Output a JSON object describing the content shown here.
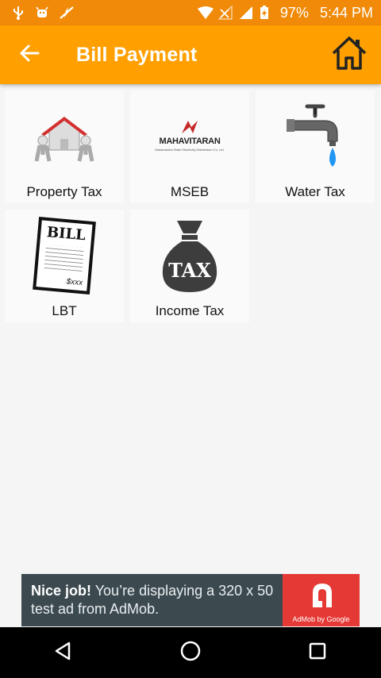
{
  "status_bar": {
    "battery": "97%",
    "time": "5:44 PM",
    "icons": [
      "usb-icon",
      "android-icon",
      "lightning-icon",
      "wifi-icon",
      "no-signal-icon",
      "signal-icon",
      "battery-charging-icon"
    ]
  },
  "app_bar": {
    "title": "Bill Payment",
    "back_icon": "arrow-left-icon",
    "home_icon": "home-icon",
    "color": "#ffa000"
  },
  "tiles": [
    {
      "label": "Property Tax",
      "icon": "house-movers-icon"
    },
    {
      "label": "MSEB",
      "icon": "mahavitaran-logo",
      "logo_text": "MAHAVITARAN",
      "logo_subtext": "Maharashtra State Electricity Distribution Co. Ltd."
    },
    {
      "label": "Water Tax",
      "icon": "faucet-icon"
    },
    {
      "label": "LBT",
      "icon": "bill-icon",
      "icon_text": "BILL",
      "icon_amount": "$xxx"
    },
    {
      "label": "Income Tax",
      "icon": "tax-bag-icon",
      "icon_text": "TAX"
    }
  ],
  "ad": {
    "headline": "Nice job!",
    "body": " You’re displaying a 320 x 50 test ad from AdMob.",
    "badge_caption": "AdMob by Google"
  },
  "nav_bar": {
    "buttons": [
      "back-triangle-icon",
      "home-circle-icon",
      "recents-square-icon"
    ]
  }
}
